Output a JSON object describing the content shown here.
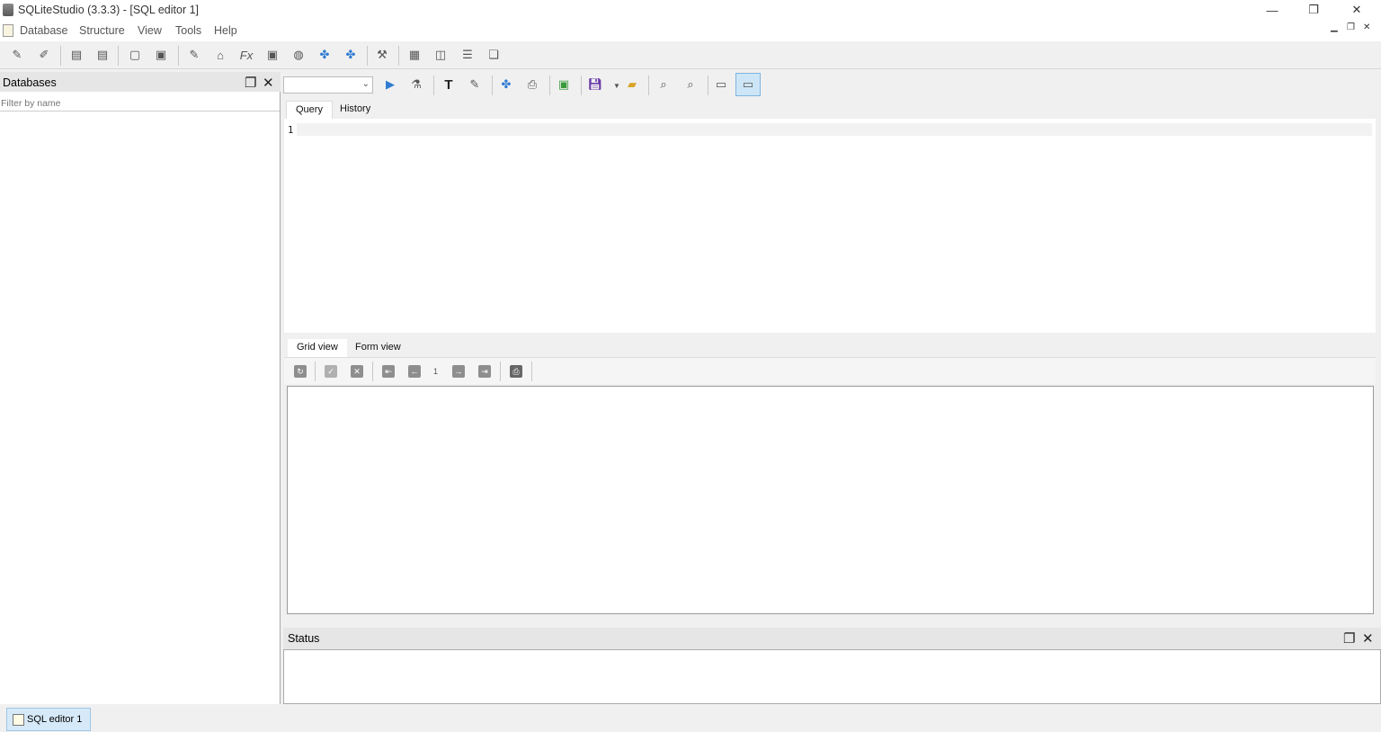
{
  "window": {
    "title": "SQLiteStudio (3.3.3) - [SQL editor 1]",
    "minimize_glyph": "—",
    "restore_glyph": "❐",
    "close_glyph": "✕"
  },
  "menu": {
    "items": [
      "Database",
      "Structure",
      "View",
      "Tools",
      "Help"
    ],
    "mdi_minimize": "▁",
    "mdi_restore": "❐",
    "mdi_close": "✕"
  },
  "databases_panel": {
    "title": "Databases",
    "filter_placeholder": "Filter by name",
    "float_glyph": "❐",
    "close_glyph": "✕"
  },
  "editor": {
    "db_select_value": "",
    "tabs": [
      "Query",
      "History"
    ],
    "active_tab": "Query",
    "line_number": "1"
  },
  "results": {
    "tabs": [
      "Grid view",
      "Form view"
    ],
    "active_tab": "Grid view",
    "page_number": "1"
  },
  "status_panel": {
    "title": "Status",
    "float_glyph": "❐",
    "close_glyph": "✕"
  },
  "taskbar": {
    "items": [
      "SQL editor 1"
    ]
  },
  "icons": {
    "main_toolbar": [
      "connect-db-icon",
      "disconnect-db-icon",
      "add-db-icon",
      "remove-db-icon",
      "import-icon",
      "export-icon",
      "open-sql-editor-icon",
      "open-ddl-history-icon",
      "sql-functions-icon",
      "collations-icon",
      "extensions-icon",
      "tile-icon",
      "tile-alt-icon",
      "settings-icon",
      "tile-horizontal-icon",
      "tile-vertical-icon",
      "cascade-icon",
      "float-window-icon"
    ],
    "editor_toolbar": [
      "execute-query-icon",
      "explain-query-icon",
      "format-sql-icon",
      "clear-icon",
      "query-exec-icon",
      "print-icon",
      "export-results-icon",
      "save-icon",
      "open-file-icon",
      "find-icon",
      "find-next-icon",
      "layout-horizontal-icon",
      "layout-vertical-icon"
    ]
  }
}
